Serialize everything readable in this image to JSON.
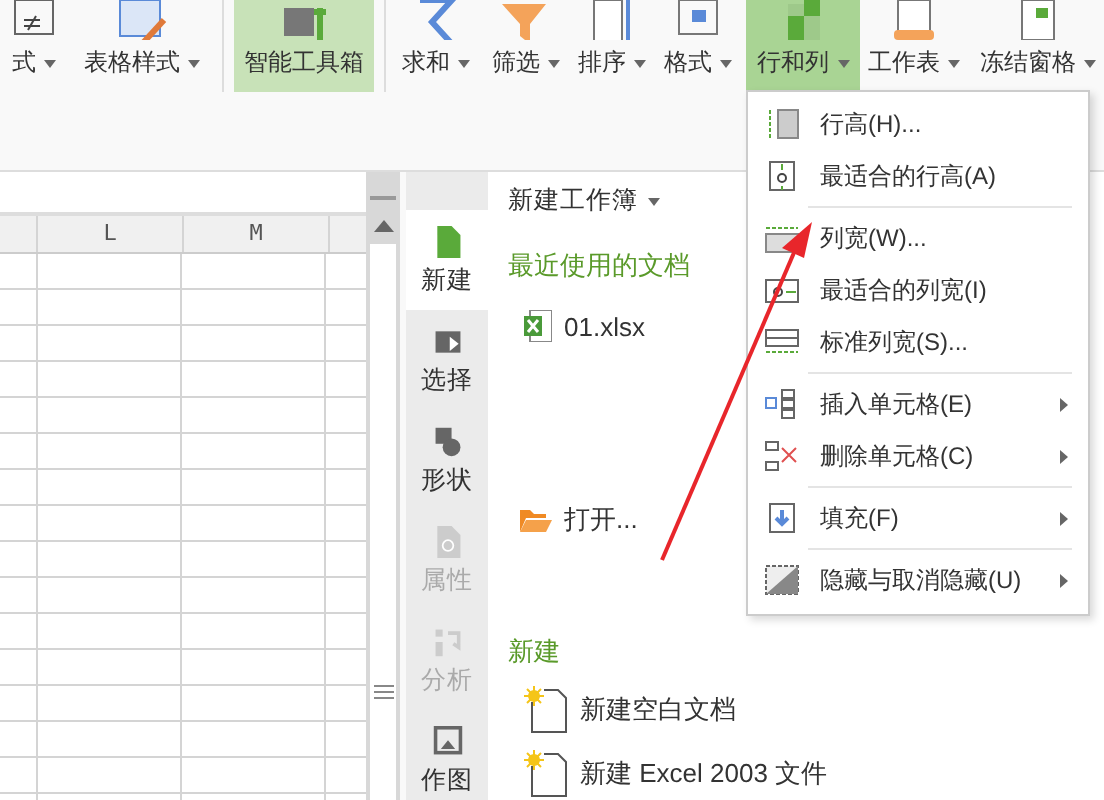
{
  "ribbon": {
    "buttons": [
      {
        "label": "式",
        "dropdown": true,
        "selected": false,
        "highlighted": false
      },
      {
        "label": "表格样式",
        "dropdown": true,
        "selected": false,
        "highlighted": false
      },
      {
        "label": "智能工具箱",
        "dropdown": false,
        "selected": false,
        "highlighted": true
      },
      {
        "label": "求和",
        "dropdown": true,
        "selected": false,
        "highlighted": false
      },
      {
        "label": "筛选",
        "dropdown": true,
        "selected": false,
        "highlighted": false
      },
      {
        "label": "排序",
        "dropdown": true,
        "selected": false,
        "highlighted": false
      },
      {
        "label": "格式",
        "dropdown": true,
        "selected": false,
        "highlighted": false
      },
      {
        "label": "行和列",
        "dropdown": true,
        "selected": true,
        "highlighted": false
      },
      {
        "label": "工作表",
        "dropdown": true,
        "selected": false,
        "highlighted": false
      },
      {
        "label": "冻结窗格",
        "dropdown": true,
        "selected": false,
        "highlighted": false
      }
    ]
  },
  "sheet": {
    "columns": [
      "L",
      "M"
    ]
  },
  "side_tabs": [
    {
      "label": "新建",
      "selected": true,
      "disabled": false
    },
    {
      "label": "选择",
      "selected": false,
      "disabled": false
    },
    {
      "label": "形状",
      "selected": false,
      "disabled": false
    },
    {
      "label": "属性",
      "selected": false,
      "disabled": true
    },
    {
      "label": "分析",
      "selected": false,
      "disabled": true
    },
    {
      "label": "作图",
      "selected": false,
      "disabled": false
    }
  ],
  "task_pane": {
    "title": "新建工作簿",
    "recent_heading": "最近使用的文档",
    "recent_files": [
      "01.xlsx"
    ],
    "open_label": "打开...",
    "new_heading": "新建",
    "new_items": [
      "新建空白文档",
      "新建 Excel 2003 文件"
    ]
  },
  "menu": {
    "groups": [
      [
        {
          "label": "行高(H)...",
          "submenu": false
        },
        {
          "label": "最适合的行高(A)",
          "submenu": false
        }
      ],
      [
        {
          "label": "列宽(W)...",
          "submenu": false
        },
        {
          "label": "最适合的列宽(I)",
          "submenu": false
        },
        {
          "label": "标准列宽(S)...",
          "submenu": false
        }
      ],
      [
        {
          "label": "插入单元格(E)",
          "submenu": true
        },
        {
          "label": "删除单元格(C)",
          "submenu": true
        }
      ],
      [
        {
          "label": "填充(F)",
          "submenu": true
        }
      ],
      [
        {
          "label": "隐藏与取消隐藏(U)",
          "submenu": true
        }
      ]
    ]
  }
}
